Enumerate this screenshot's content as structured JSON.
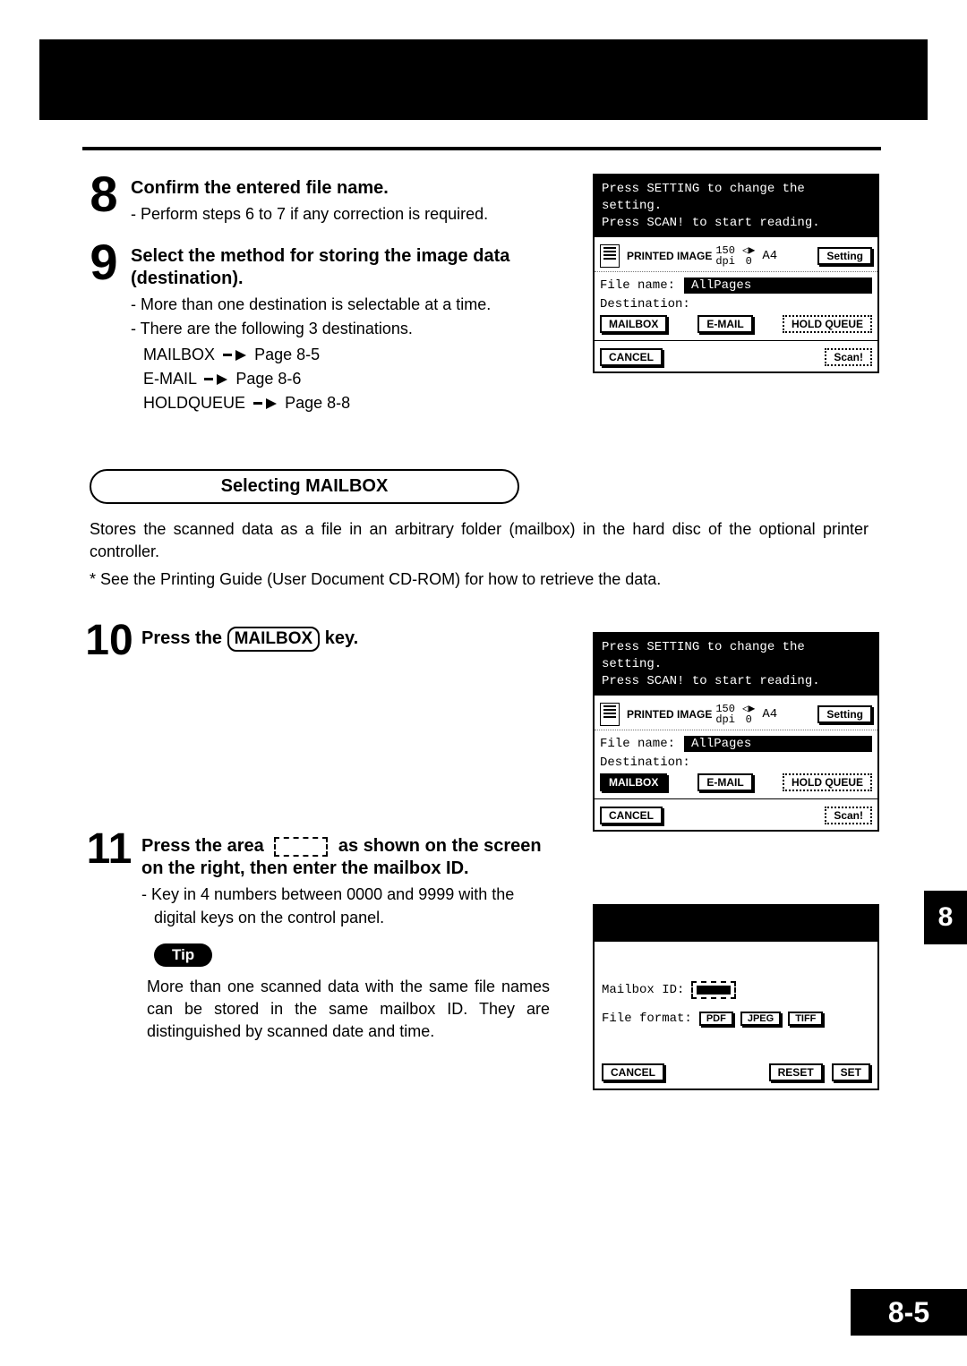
{
  "steps": {
    "s8": {
      "num": "8",
      "title": "Confirm the entered file name.",
      "bullet1": "Perform steps 6 to 7 if any correction is required."
    },
    "s9": {
      "num": "9",
      "title": "Select the method for storing the image data (destination).",
      "bullet1": "More than one destination is selectable at a time.",
      "bullet2": "There are the following 3 destinations.",
      "dest_mailbox": "MAILBOX",
      "dest_mailbox_page": "Page 8-5",
      "dest_email": "E-MAIL",
      "dest_email_page": "Page 8-6",
      "dest_hold": "HOLDQUEUE",
      "dest_hold_page": "Page 8-8"
    },
    "s10": {
      "num": "10",
      "title_pre": "Press the ",
      "key": "MAILBOX",
      "title_post": " key."
    },
    "s11": {
      "num": "11",
      "title_pre": "Press the area ",
      "title_post": " as shown on the screen on the right, then enter the mailbox ID.",
      "bullet1": "Key in 4 numbers between 0000 and 9999 with the digital keys on the control panel."
    }
  },
  "section_header": "Selecting MAILBOX",
  "section_body1": "Stores the scanned data as a file in an arbitrary folder (mailbox) in the hard disc of the optional printer controller.",
  "section_body2": "* See the Printing Guide (User Document CD-ROM) for how to retrieve the data.",
  "tip_label": "Tip",
  "tip_body": "More than one scanned data with the same file names can be stored in the same mailbox ID. They are distinguished by scanned date and time.",
  "lcd_common": {
    "msg_l1": "Press SETTING to change the setting.",
    "msg_l2": "Press SCAN! to start reading.",
    "printed_image": "PRINTED IMAGE",
    "dpi_value": "150",
    "dpi_unit": "dpi",
    "rotate_num": "0",
    "paper": "A4",
    "setting_btn": "Setting",
    "file_name_label": "File name:",
    "file_name_value": "AllPages",
    "destination_label": "Destination:",
    "mailbox_btn": "MAILBOX",
    "email_btn": "E-MAIL",
    "holdqueue_btn": "HOLD QUEUE",
    "cancel_btn": "CANCEL",
    "scan_btn": "Scan!"
  },
  "lcd3": {
    "mailbox_id_label": "Mailbox ID:",
    "file_format_label": "File format:",
    "pdf_btn": "PDF",
    "jpeg_btn": "JPEG",
    "tiff_btn": "TIFF",
    "cancel_btn": "CANCEL",
    "reset_btn": "RESET",
    "set_btn": "SET"
  },
  "side_tab": "8",
  "footer_page": "8-5"
}
